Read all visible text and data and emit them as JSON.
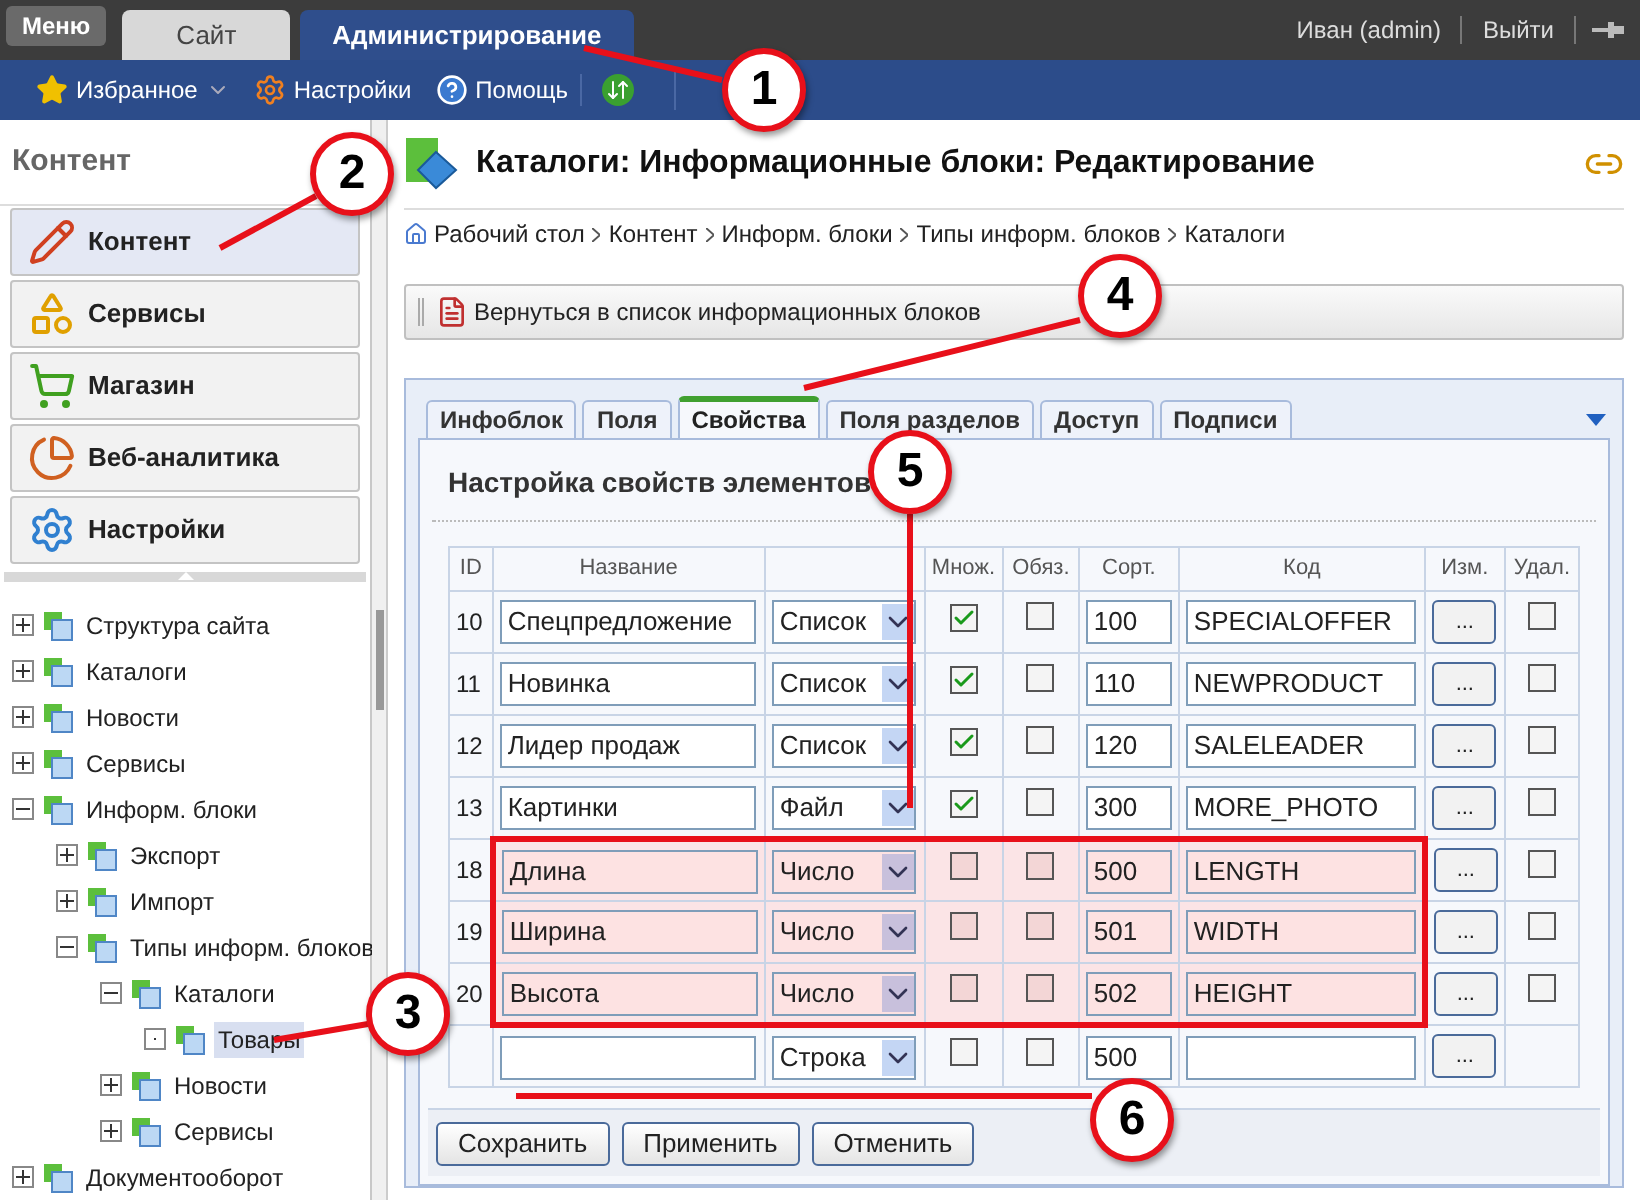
{
  "top_bar": {
    "menu_button": "Меню",
    "tabs": [
      {
        "label": "Сайт",
        "selected": false
      },
      {
        "label": "Администрирование",
        "selected": true
      }
    ],
    "user": "Иван (admin)",
    "logout": "Выйти"
  },
  "toolbar": {
    "items": [
      {
        "label": "Избранное",
        "kind": "dropdown"
      },
      {
        "label": "Настройки",
        "kind": "link"
      },
      {
        "label": "Помощь",
        "kind": "link"
      },
      {
        "kind": "icon"
      }
    ]
  },
  "sidebar": {
    "title": "Контент",
    "menu": [
      {
        "label": "Контент",
        "selected": true
      },
      {
        "label": "Сервисы",
        "selected": false
      },
      {
        "label": "Магазин",
        "selected": false
      },
      {
        "label": "Веб-аналитика",
        "selected": false
      },
      {
        "label": "Настройки",
        "selected": false
      }
    ],
    "tree": [
      {
        "label": "Структура сайта",
        "expanded": false,
        "selected": false
      },
      {
        "label": "Каталоги",
        "expanded": false,
        "selected": false
      },
      {
        "label": "Новости",
        "expanded": false,
        "selected": false
      },
      {
        "label": "Сервисы",
        "expanded": false,
        "selected": false
      },
      {
        "label": "Информ. блоки",
        "expanded": true,
        "selected": false,
        "children": [
          {
            "label": "Экспорт",
            "expanded": false,
            "selected": false
          },
          {
            "label": "Импорт",
            "expanded": false,
            "selected": false
          },
          {
            "label": "Типы информ. блоков",
            "expanded": true,
            "selected": false,
            "children": [
              {
                "label": "Каталоги",
                "expanded": true,
                "selected": false,
                "children": [
                  {
                    "label": "Товары",
                    "expanded": false,
                    "leaf": true,
                    "selected": true
                  }
                ]
              },
              {
                "label": "Новости",
                "expanded": false,
                "selected": false
              },
              {
                "label": "Сервисы",
                "expanded": false,
                "selected": false
              }
            ]
          }
        ]
      },
      {
        "label": "Документооборот",
        "expanded": false,
        "selected": false
      }
    ]
  },
  "content": {
    "title": "Каталоги: Информационные блоки: Редактирование",
    "breadcrumb": [
      "Рабочий стол",
      "Контент",
      "Информ. блоки",
      "Типы информ. блоков",
      "Каталоги"
    ],
    "back_button": "Вернуться в список информационных блоков",
    "tabs": [
      {
        "label": "Инфоблок",
        "selected": false
      },
      {
        "label": "Поля",
        "selected": false
      },
      {
        "label": "Свойства",
        "selected": true
      },
      {
        "label": "Поля разделов",
        "selected": false
      },
      {
        "label": "Доступ",
        "selected": false
      },
      {
        "label": "Подписи",
        "selected": false
      }
    ],
    "section_title": "Настройка свойств элементов",
    "table": {
      "columns": {
        "id": "ID",
        "name": "Название",
        "multiple": "Множ.",
        "required": "Обяз.",
        "sort": "Сорт.",
        "code": "Код",
        "edit": "Изм.",
        "delete": "Удал."
      },
      "rows": [
        {
          "kind": "existing",
          "id": "10",
          "name": "Спецпредложение",
          "type": "Список",
          "multiple": true,
          "required": false,
          "sort": "100",
          "code": "SPECIALOFFER",
          "edit": "...",
          "delete": false,
          "highlighted": false
        },
        {
          "kind": "existing",
          "id": "11",
          "name": "Новинка",
          "type": "Список",
          "multiple": true,
          "required": false,
          "sort": "110",
          "code": "NEWPRODUCT",
          "edit": "...",
          "delete": false,
          "highlighted": false
        },
        {
          "kind": "existing",
          "id": "12",
          "name": "Лидер продаж",
          "type": "Список",
          "multiple": true,
          "required": false,
          "sort": "120",
          "code": "SALELEADER",
          "edit": "...",
          "delete": false,
          "highlighted": false
        },
        {
          "kind": "existing",
          "id": "13",
          "name": "Картинки",
          "type": "Файл",
          "multiple": true,
          "required": false,
          "sort": "300",
          "code": "MORE_PHOTO",
          "edit": "...",
          "delete": false,
          "highlighted": false
        },
        {
          "kind": "existing",
          "id": "18",
          "name": "Длина",
          "type": "Число",
          "multiple": false,
          "required": false,
          "sort": "500",
          "code": "LENGTH",
          "edit": "...",
          "delete": false,
          "highlighted": true
        },
        {
          "kind": "existing",
          "id": "19",
          "name": "Ширина",
          "type": "Число",
          "multiple": false,
          "required": false,
          "sort": "501",
          "code": "WIDTH",
          "edit": "...",
          "delete": false,
          "highlighted": true
        },
        {
          "kind": "existing",
          "id": "20",
          "name": "Высота",
          "type": "Число",
          "multiple": false,
          "required": false,
          "sort": "502",
          "code": "HEIGHT",
          "edit": "...",
          "delete": false,
          "highlighted": true
        },
        {
          "kind": "new",
          "type": "Строка",
          "multiple": false,
          "required": false,
          "sort": "500",
          "edit": "...",
          "highlighted": false
        }
      ]
    },
    "buttons": [
      "Сохранить",
      "Применить",
      "Отменить"
    ]
  },
  "callouts": [
    "1",
    "2",
    "3",
    "4",
    "5",
    "6"
  ]
}
